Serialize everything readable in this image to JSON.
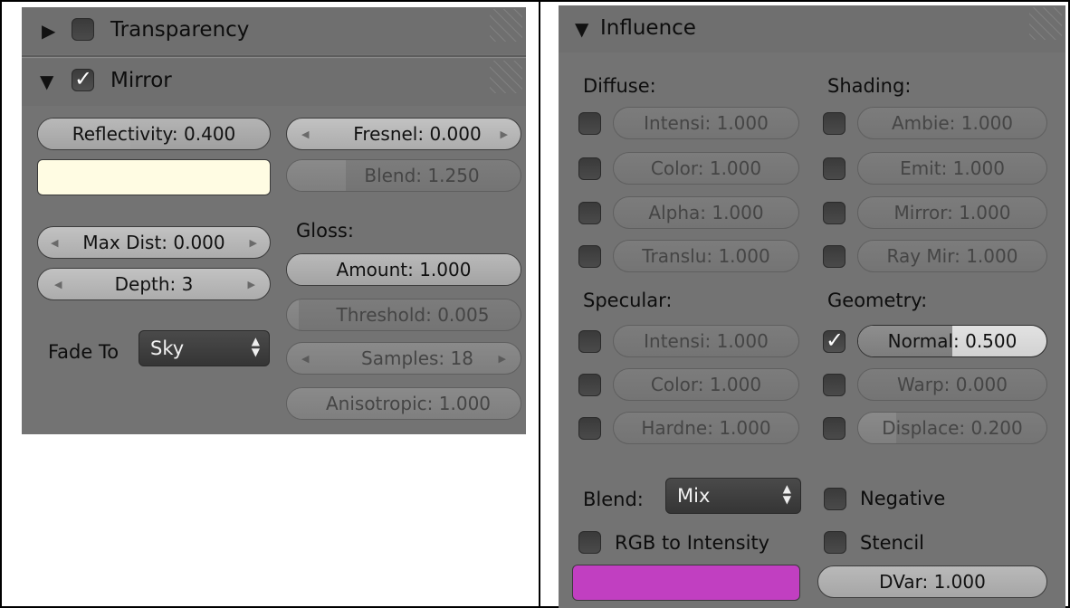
{
  "left": {
    "transparency": {
      "title": "Transparency",
      "enabled": false
    },
    "mirror": {
      "title": "Mirror",
      "enabled": true,
      "reflectivity": {
        "label": "Reflectivity: 0.400",
        "fraction": 0.4
      },
      "mirror_color": "#fffce3",
      "fresnel": "Fresnel: 0.000",
      "blend": {
        "label": "Blend: 1.250",
        "fraction": 0.25
      },
      "max_dist": "Max Dist: 0.000",
      "depth": "Depth: 3",
      "gloss_label": "Gloss:",
      "amount": {
        "label": "Amount: 1.000",
        "fraction": 1.0
      },
      "threshold": {
        "label": "Threshold: 0.005",
        "fraction": 0.05
      },
      "samples": "Samples: 18",
      "anisotropic": {
        "label": "Anisotropic: 1.000",
        "fraction": 1.0
      },
      "fade_to_label": "Fade To",
      "fade_to_value": "Sky"
    }
  },
  "right": {
    "influence_title": "Influence",
    "diffuse": {
      "label": "Diffuse:",
      "items": [
        {
          "label": "Intensi: 1.000",
          "enabled": false
        },
        {
          "label": "Color: 1.000",
          "enabled": false
        },
        {
          "label": "Alpha: 1.000",
          "enabled": false
        },
        {
          "label": "Translu: 1.000",
          "enabled": false
        }
      ]
    },
    "shading": {
      "label": "Shading:",
      "items": [
        {
          "label": "Ambie: 1.000",
          "enabled": false
        },
        {
          "label": "Emit: 1.000",
          "enabled": false
        },
        {
          "label": "Mirror: 1.000",
          "enabled": false
        },
        {
          "label": "Ray Mir: 1.000",
          "enabled": false
        }
      ]
    },
    "specular": {
      "label": "Specular:",
      "items": [
        {
          "label": "Intensi: 1.000",
          "enabled": false
        },
        {
          "label": "Color: 1.000",
          "enabled": false
        },
        {
          "label": "Hardne: 1.000",
          "enabled": false
        }
      ]
    },
    "geometry": {
      "label": "Geometry:",
      "items": [
        {
          "label": "Normal: 0.500",
          "enabled": true,
          "fraction": 0.5
        },
        {
          "label": "Warp: 0.000",
          "enabled": false,
          "fraction": 0.0
        },
        {
          "label": "Displace: 0.200",
          "enabled": false,
          "fraction": 0.2
        }
      ]
    },
    "blend_label": "Blend:",
    "blend_value": "Mix",
    "negative": {
      "label": "Negative",
      "enabled": false
    },
    "rgb_to_intensity": {
      "label": "RGB to Intensity",
      "enabled": false
    },
    "stencil": {
      "label": "Stencil",
      "enabled": false
    },
    "color": "#c13fc1",
    "dvar": "DVar: 1.000"
  },
  "colors": {
    "panel_bg": "#737373",
    "header_bg": "#6b6b6b"
  }
}
